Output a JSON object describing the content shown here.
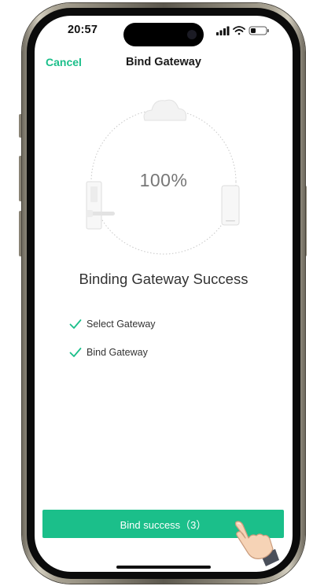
{
  "status_bar": {
    "time": "20:57",
    "icons": [
      "signal-icon",
      "wifi-icon",
      "battery-icon"
    ]
  },
  "nav": {
    "cancel_label": "Cancel",
    "title": "Bind Gateway"
  },
  "progress": {
    "percent_label": "100%",
    "value": 1.0
  },
  "illustration": {
    "icons": [
      "cloud-icon",
      "lock-device-icon",
      "phone-device-icon"
    ]
  },
  "headline": "Binding Gateway Success",
  "steps": [
    {
      "label": "Select Gateway",
      "done": true
    },
    {
      "label": "Bind Gateway",
      "done": true
    }
  ],
  "action": {
    "button_label": "Bind success（3）"
  },
  "colors": {
    "accent": "#1bbf8a",
    "text_primary": "#333333",
    "text_muted": "#777777"
  }
}
